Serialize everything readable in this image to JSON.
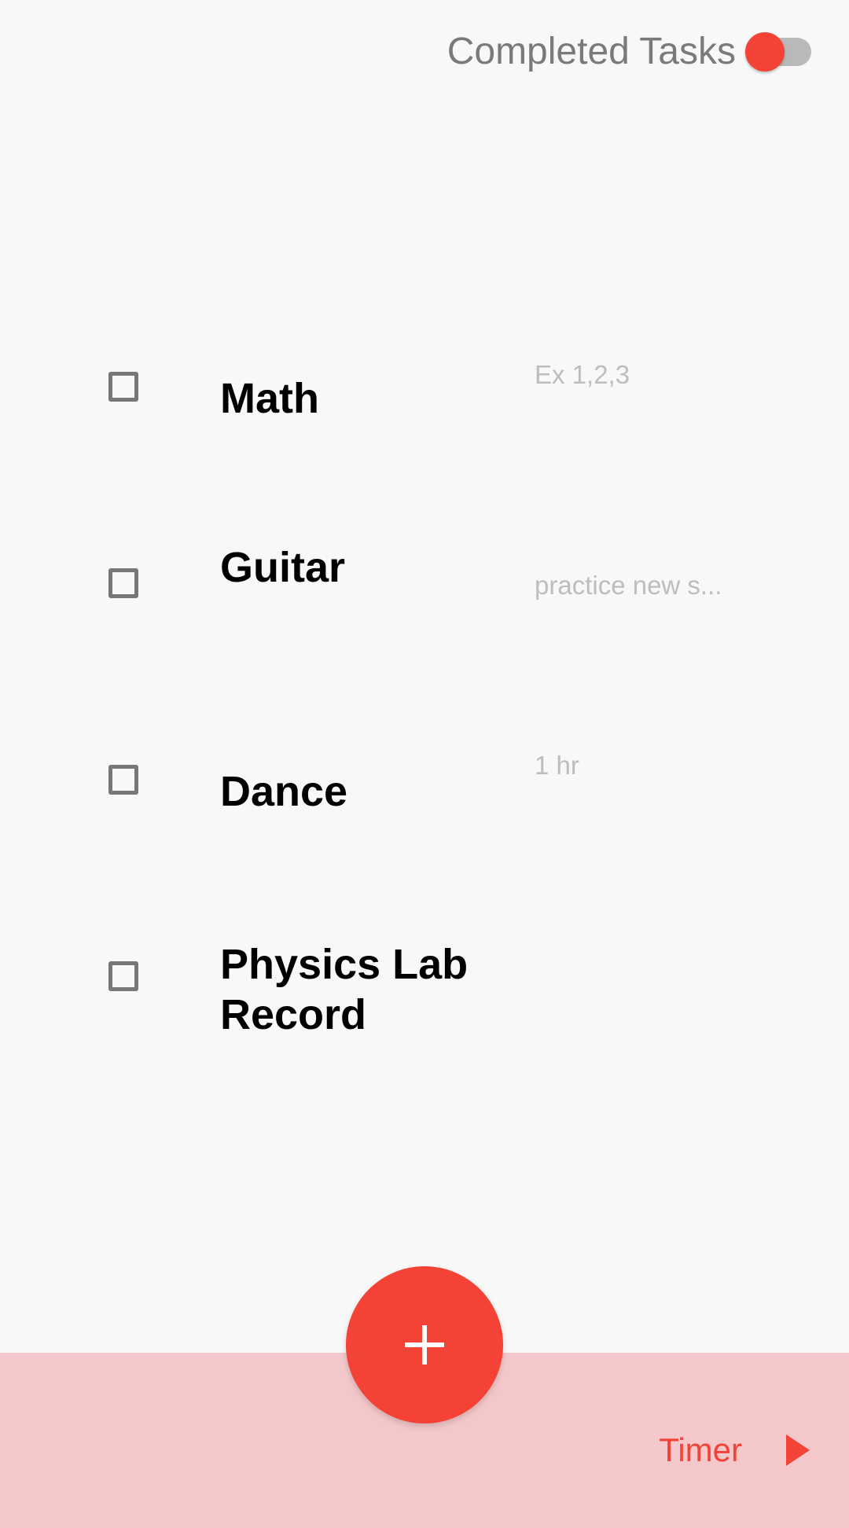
{
  "header": {
    "toggle_label": "Completed Tasks",
    "toggle_on": false
  },
  "tasks": [
    {
      "title": "Math",
      "note": "Ex 1,2,3",
      "completed": false
    },
    {
      "title": "Guitar",
      "note": "practice new s...",
      "completed": false
    },
    {
      "title": "Dance",
      "note": "1 hr",
      "completed": false
    },
    {
      "title": "Physics Lab Record",
      "note": "",
      "completed": false
    }
  ],
  "bottom_bar": {
    "timer_label": "Timer",
    "play_icon": "play-icon"
  },
  "fab": {
    "icon": "plus-icon"
  },
  "colors": {
    "accent": "#f44336",
    "background": "#f8f8f8",
    "bottom_bar": "#f4c8ca",
    "note_text": "#bdbdbd",
    "checkbox_border": "#777777"
  }
}
